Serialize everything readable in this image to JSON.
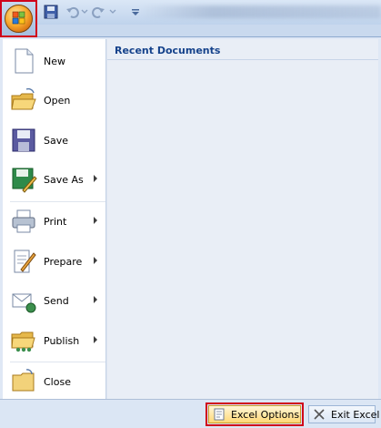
{
  "menu": {
    "recent_title": "Recent Documents",
    "items": [
      {
        "label": "New"
      },
      {
        "label": "Open"
      },
      {
        "label": "Save"
      },
      {
        "label": "Save As"
      },
      {
        "label": "Print"
      },
      {
        "label": "Prepare"
      },
      {
        "label": "Send"
      },
      {
        "label": "Publish"
      },
      {
        "label": "Close"
      }
    ]
  },
  "bottom": {
    "excel_options_label": "Excel Options",
    "exit_label": "Exit Excel"
  },
  "colors": {
    "highlight_outline": "#d0021b",
    "menu_text": "#15428b",
    "pane_background": "#e9eef6"
  }
}
